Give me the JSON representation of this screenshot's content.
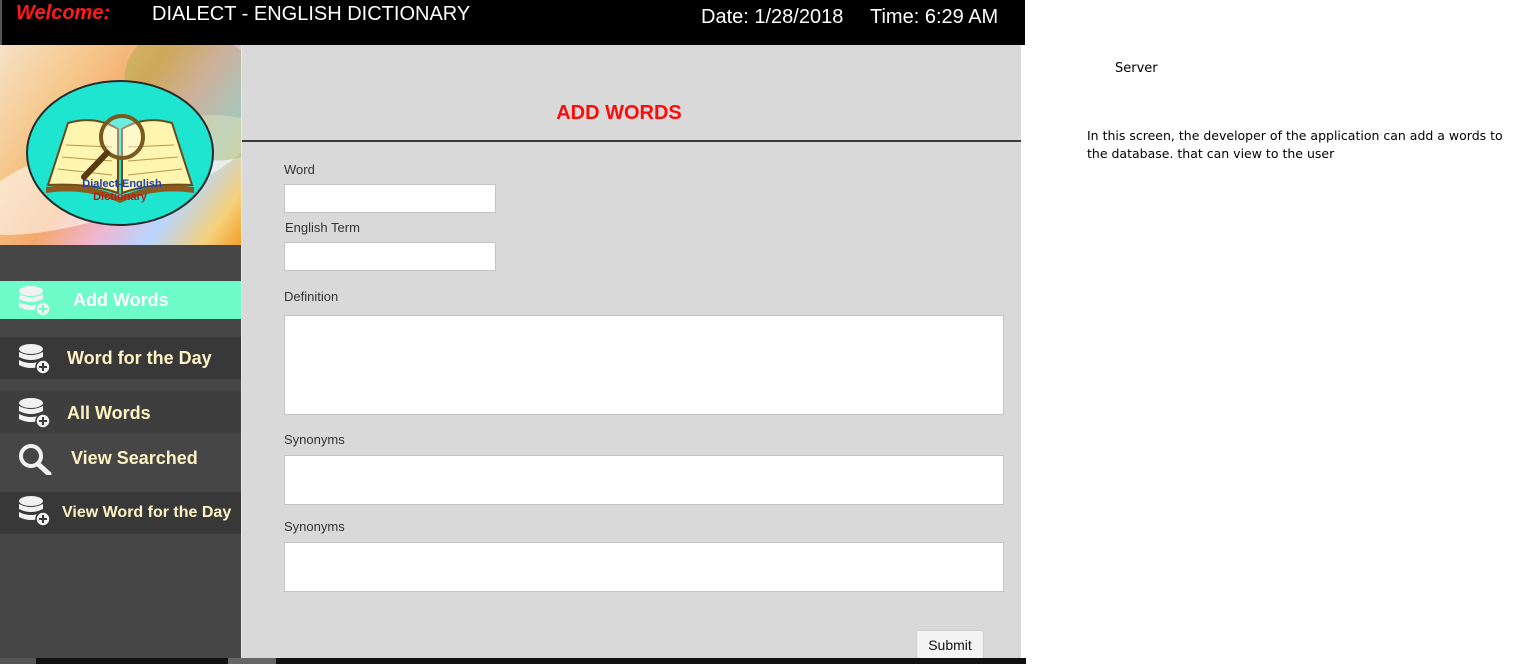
{
  "header": {
    "welcome": "Welcome:",
    "app_title": "DIALECT - ENGLISH DICTIONARY",
    "date": "Date: 1/28/2018",
    "time": "Time: 6:29 AM"
  },
  "logo": {
    "line1": "Dialect-English",
    "line2": "Dictionary"
  },
  "sidebar": {
    "items": [
      {
        "label": "Add Words",
        "icon": "database-add-icon",
        "active": true
      },
      {
        "label": "Word for the Day",
        "icon": "database-add-icon"
      },
      {
        "label": "All Words",
        "icon": "database-add-icon"
      },
      {
        "label": "View Searched",
        "icon": "search-icon"
      },
      {
        "label": "View Word for the Day",
        "icon": "database-add-icon"
      }
    ]
  },
  "form": {
    "title": "ADD WORDS",
    "fields": [
      {
        "label": "Word",
        "value": ""
      },
      {
        "label": "English Term",
        "value": ""
      },
      {
        "label": "Definition",
        "value": ""
      },
      {
        "label": "Synonyms",
        "value": ""
      },
      {
        "label": "Synonyms",
        "value": ""
      }
    ],
    "submit_label": "Submit"
  },
  "notes": {
    "server": "Server",
    "description": "In this screen, the developer of the application can add a words to the database. that can view to the user"
  },
  "colors": {
    "title_red": "#ff0a0a",
    "active_nav": "#6dfcc9",
    "sidebar_bg": "#464646",
    "main_bg": "#d9d9d9"
  }
}
